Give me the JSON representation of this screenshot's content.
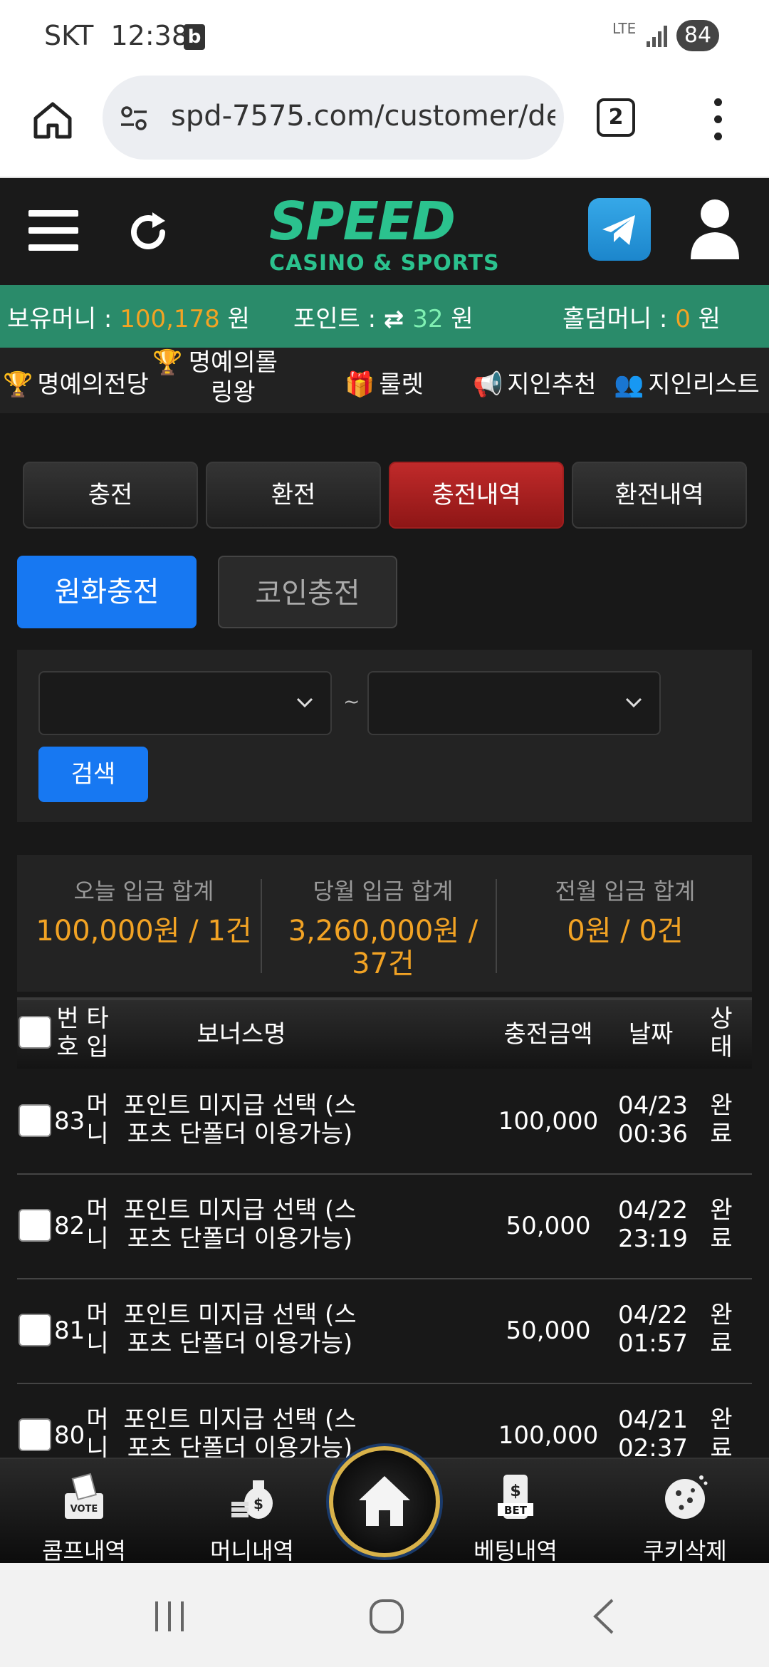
{
  "status_bar": {
    "carrier": "SKT",
    "time": "12:38",
    "network": "LTE",
    "battery": "84"
  },
  "browser": {
    "url": "spd-7575.com/customer/de",
    "tab_count": "2"
  },
  "header": {
    "logo_main": "SPEED",
    "logo_sub": "CASINO & SPORTS"
  },
  "money": {
    "holding_label": "보유머니 : ",
    "holding_value": "100,178",
    "holding_unit": " 원",
    "point_label": "포인트 : ",
    "point_value": "32",
    "point_unit": " 원",
    "holdem_label": "홀덤머니 : ",
    "holdem_value": "0",
    "holdem_unit": " 원"
  },
  "menu": [
    {
      "label": "명예의전당"
    },
    {
      "label": "명예의롤링왕"
    },
    {
      "label": "룰렛"
    },
    {
      "label": "지인추천"
    },
    {
      "label": "지인리스트"
    }
  ],
  "tabs": [
    {
      "label": "충전"
    },
    {
      "label": "환전"
    },
    {
      "label": "충전내역"
    },
    {
      "label": "환전내역"
    }
  ],
  "subtabs": {
    "krw": "원화충전",
    "coin": "코인충전"
  },
  "filter": {
    "separator": "~",
    "search_label": "검색"
  },
  "summary": [
    {
      "label": "오늘 입금 합계",
      "value": "100,000원 / 1건"
    },
    {
      "label": "당월 입금 합계",
      "value": "3,260,000원 / 37건"
    },
    {
      "label": "전월 입금 합계",
      "value": "0원 / 0건"
    }
  ],
  "table": {
    "headers": {
      "no": "번호",
      "type": "타입",
      "bonus": "보너스명",
      "amount": "충전금액",
      "date": "날짜",
      "status": "상태"
    },
    "rows": [
      {
        "no": "83",
        "type": "머니",
        "bonus": "포인트 미지급 선택 (스포츠 단폴더 이용가능)",
        "amount": "100,000",
        "date": "04/23",
        "time": "00:36",
        "status": "완료"
      },
      {
        "no": "82",
        "type": "머니",
        "bonus": "포인트 미지급 선택 (스포츠 단폴더 이용가능)",
        "amount": "50,000",
        "date": "04/22",
        "time": "23:19",
        "status": "완료"
      },
      {
        "no": "81",
        "type": "머니",
        "bonus": "포인트 미지급 선택 (스포츠 단폴더 이용가능)",
        "amount": "50,000",
        "date": "04/22",
        "time": "01:57",
        "status": "완료"
      },
      {
        "no": "80",
        "type": "머니",
        "bonus": "포인트 미지급 선택 (스포츠 단폴더 이용가능)",
        "amount": "100,000",
        "date": "04/21",
        "time": "02:37",
        "status": "완료"
      }
    ]
  },
  "bottom_nav": {
    "comp": "콤프내역",
    "money": "머니내역",
    "betting": "베팅내역",
    "cookie": "쿠키삭제",
    "bet_badge": "BET",
    "vote_badge": "VOTE"
  }
}
